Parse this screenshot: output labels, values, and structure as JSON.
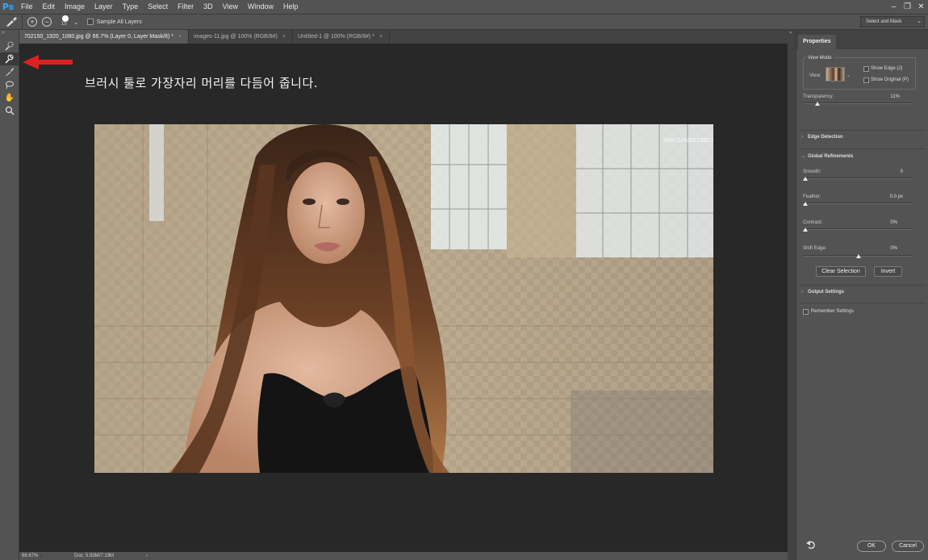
{
  "menubar": {
    "logo": "Ps",
    "items": [
      "File",
      "Edit",
      "Image",
      "Layer",
      "Type",
      "Select",
      "Filter",
      "3D",
      "View",
      "Window",
      "Help"
    ],
    "window_controls": [
      "–",
      "❐",
      "✕"
    ]
  },
  "options": {
    "add_glyph": "+",
    "subtract_glyph": "−",
    "brush_size": "15",
    "sample_all_layers": "Sample All Layers",
    "workspace": "Select and Mask"
  },
  "tabs": [
    {
      "label": "702150_1920_1080.jpg @ 66.7% (Layer 0, Layer Mask/8) *",
      "active": true
    },
    {
      "label": "images-11.jpg @ 100% (RGB/8#)",
      "active": false
    },
    {
      "label": "Untitled-1 @ 100% (RGB/8#) *",
      "active": false
    }
  ],
  "tab_close": "×",
  "canvas": {
    "instruction": "브러시 툴로 가장자리 머리를 다듬어 줍니다."
  },
  "status": {
    "zoom": "66.67%",
    "doc": "Doc: 5.93M/7.19M",
    "arrow": "›"
  },
  "properties": {
    "tab": "Properties",
    "view_mode_title": "View Mode",
    "view_label": "View:",
    "show_edge": "Show Edge (J)",
    "show_original": "Show Original (P)",
    "transparency_label": "Transparency:",
    "transparency_value": "11%",
    "transparency_level": 0.11,
    "edge_detection": "Edge Detection",
    "global_refinements": "Global Refinements",
    "smooth_label": "Smooth:",
    "smooth_value": "0",
    "feather_label": "Feather:",
    "feather_value": "0.0 px",
    "contrast_label": "Contrast:",
    "contrast_value": "0%",
    "shift_edge_label": "Shift Edge:",
    "shift_edge_value": "0%",
    "clear_selection": "Clear Selection",
    "invert": "Invert",
    "output_settings": "Output Settings",
    "remember_settings": "Remember Settings",
    "ok": "OK",
    "cancel": "Cancel"
  },
  "colors": {
    "accent_arrow": "#e02020",
    "ps_blue": "#31a8ff"
  },
  "icons": [
    "quick-selection-brush-icon",
    "refine-edge-brush-icon",
    "brush-icon",
    "lasso-icon",
    "hand-icon",
    "zoom-icon",
    "undo-icon"
  ]
}
